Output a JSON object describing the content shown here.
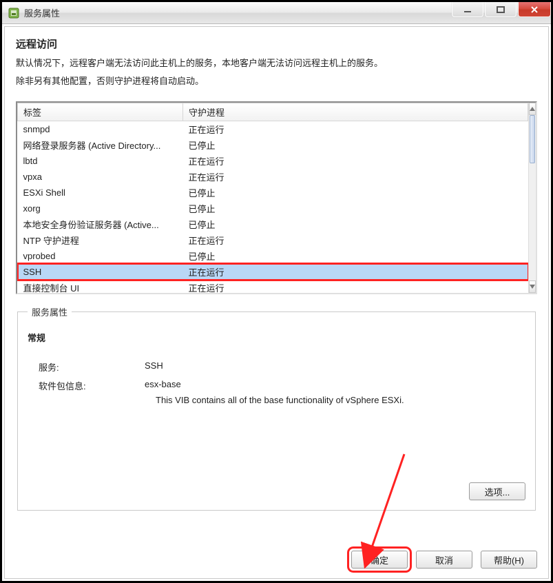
{
  "titlebar": {
    "title": "服务属性"
  },
  "section": {
    "heading": "远程访问",
    "line1": "默认情况下，远程客户端无法访问此主机上的服务，本地客户端无法访问远程主机上的服务。",
    "line2": "除非另有其他配置，否则守护进程将自动启动。"
  },
  "table": {
    "columns": {
      "label": "标签",
      "daemon": "守护进程"
    },
    "rows": [
      {
        "label": "snmpd",
        "daemon": "正在运行"
      },
      {
        "label": "网络登录服务器 (Active Directory...",
        "daemon": "已停止"
      },
      {
        "label": "lbtd",
        "daemon": "正在运行"
      },
      {
        "label": "vpxa",
        "daemon": "正在运行"
      },
      {
        "label": "ESXi Shell",
        "daemon": "已停止"
      },
      {
        "label": "xorg",
        "daemon": "已停止"
      },
      {
        "label": "本地安全身份验证服务器 (Active...",
        "daemon": "已停止"
      },
      {
        "label": "NTP 守护进程",
        "daemon": "正在运行"
      },
      {
        "label": "vprobed",
        "daemon": "已停止"
      },
      {
        "label": "SSH",
        "daemon": "正在运行",
        "selected": true,
        "highlighted": true
      },
      {
        "label": "直接控制台 UI",
        "daemon": "正在运行"
      }
    ]
  },
  "properties": {
    "legend": "服务属性",
    "sub": "常规",
    "service_label": "服务:",
    "service_value": "SSH",
    "package_label": "软件包信息:",
    "package_value": "esx-base",
    "package_desc": "This VIB contains all of the base functionality of vSphere ESXi.",
    "options_btn": "选项..."
  },
  "footer": {
    "ok": "确定",
    "cancel": "取消",
    "help": "帮助(H)"
  },
  "colors": {
    "highlight": "#f22"
  }
}
